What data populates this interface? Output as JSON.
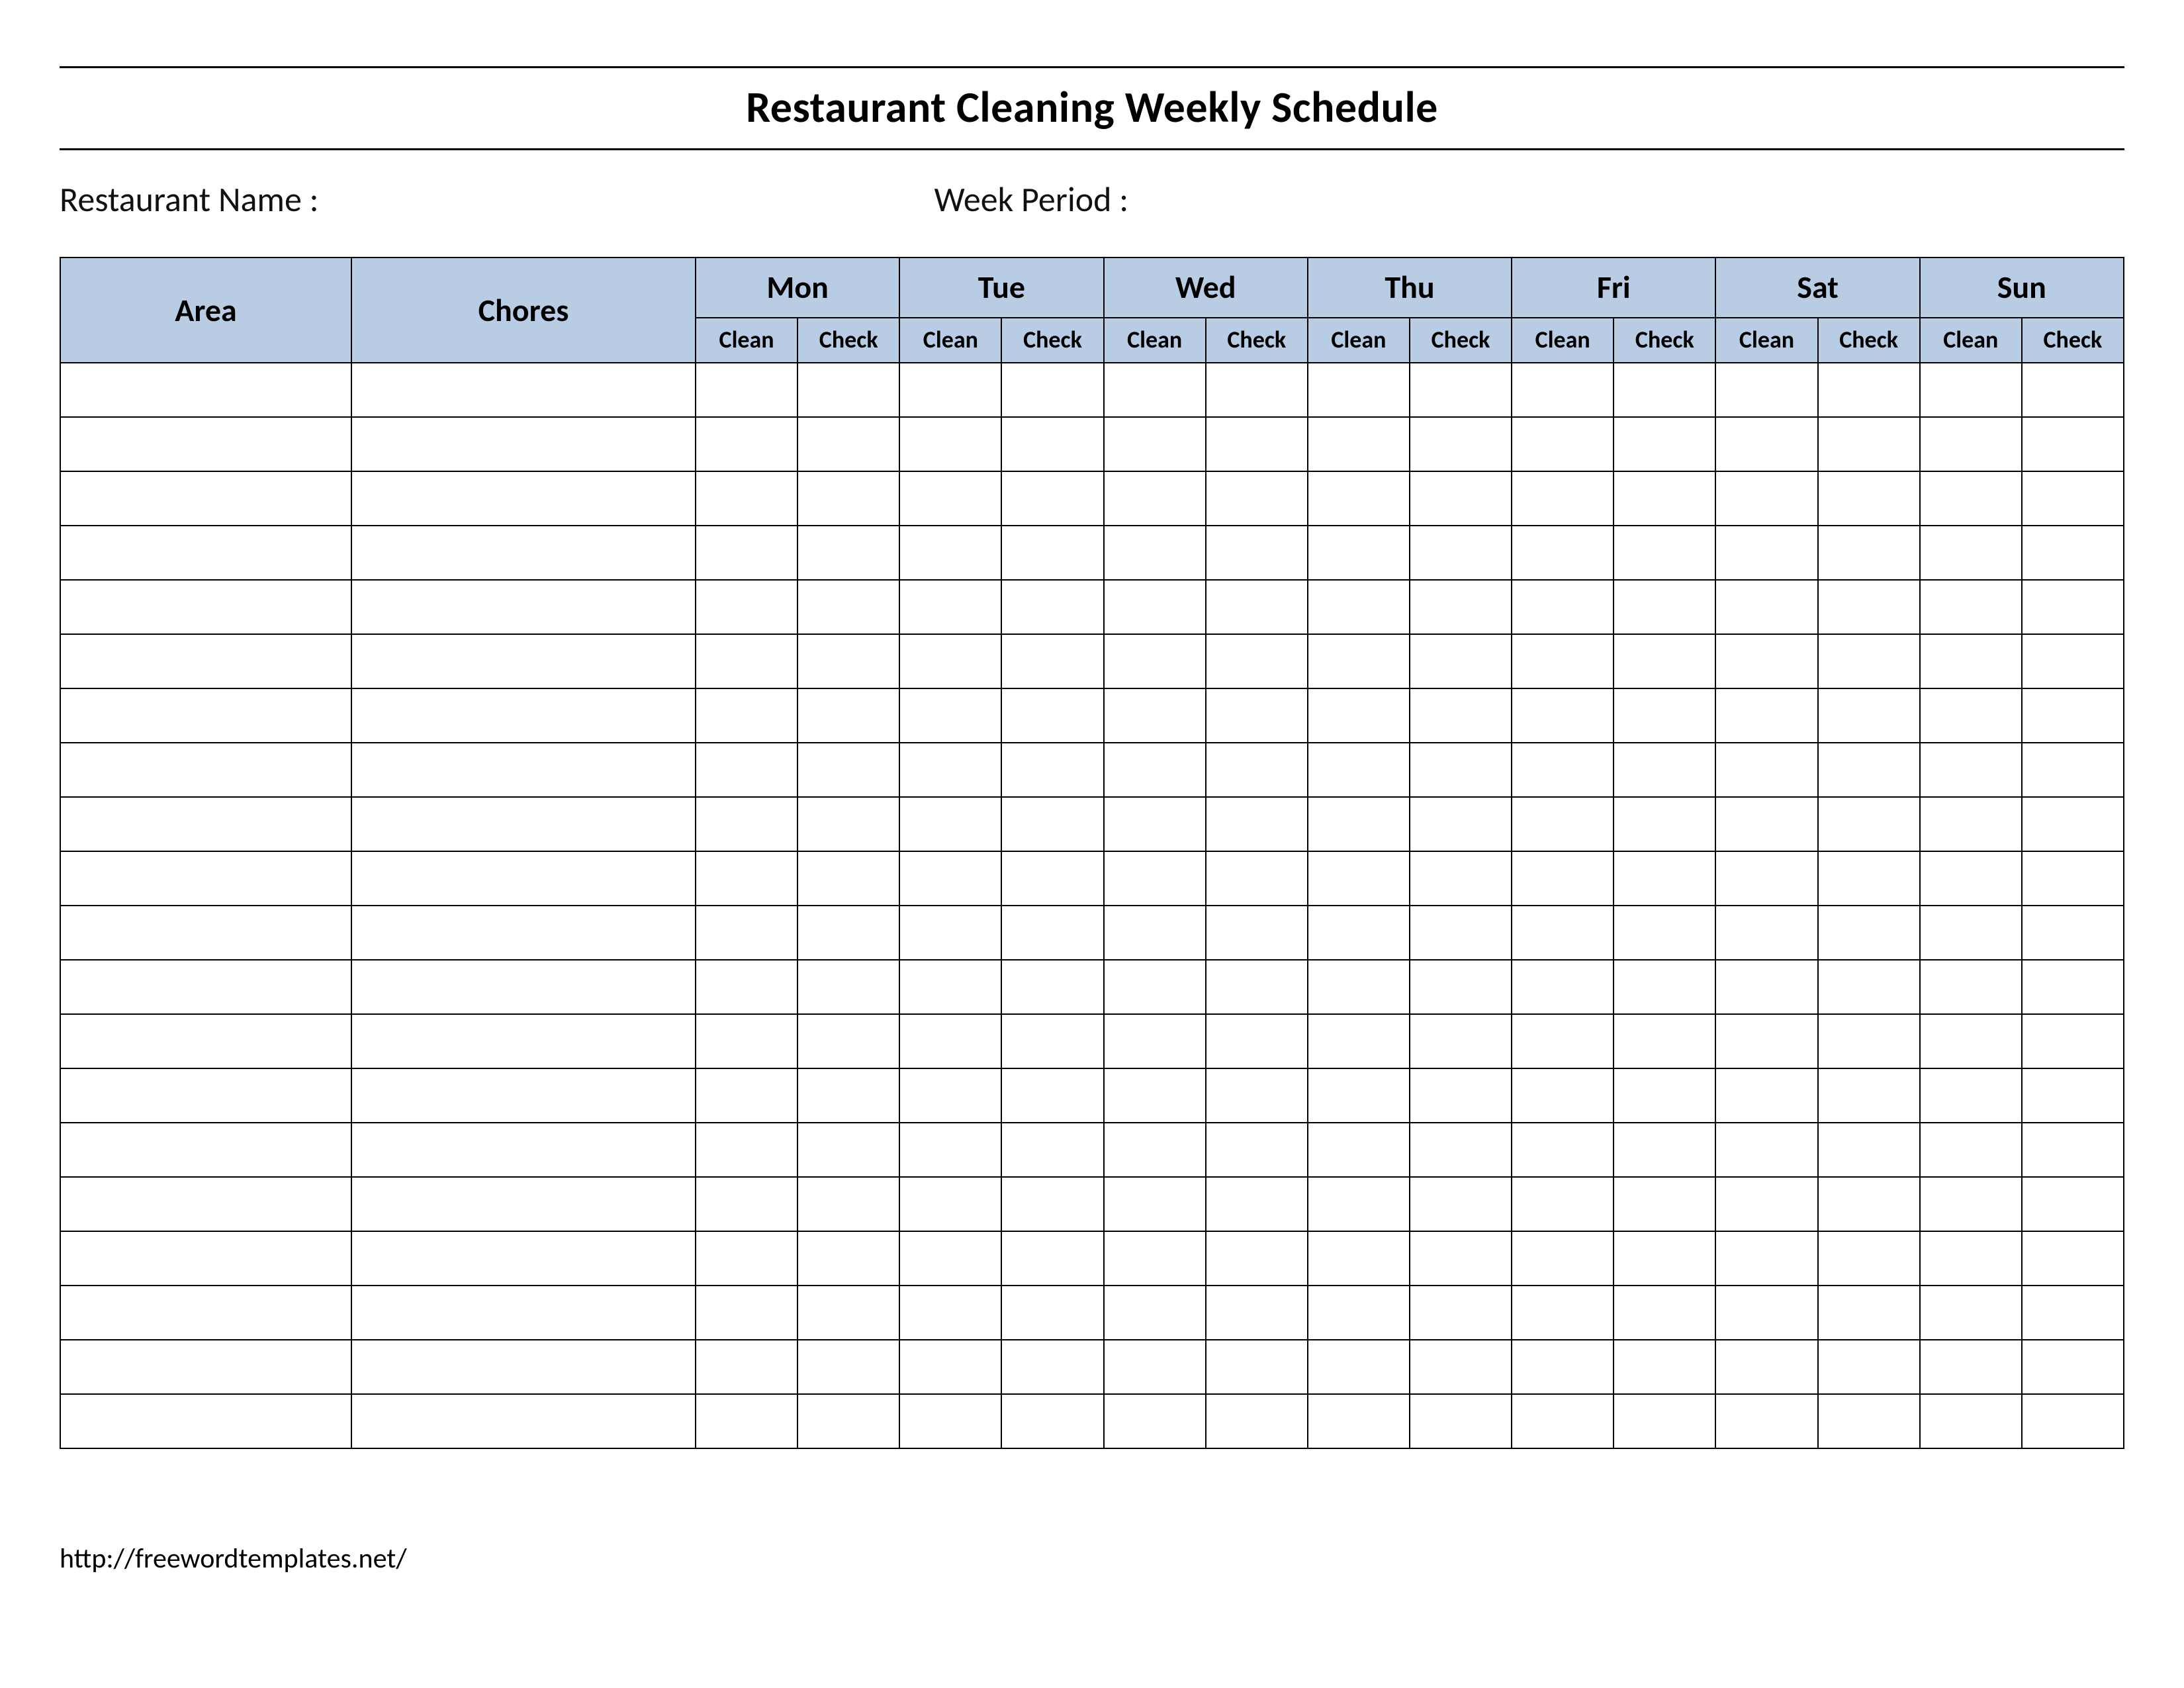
{
  "title": "Restaurant Cleaning Weekly Schedule",
  "meta": {
    "restaurant_name_label": "Restaurant Name   :",
    "week_period_label": "Week  Period :"
  },
  "table": {
    "area_header": "Area",
    "chores_header": "Chores",
    "days": [
      "Mon",
      "Tue",
      "Wed",
      "Thu",
      "Fri",
      "Sat",
      "Sun"
    ],
    "sub_clean": "Clean",
    "sub_check": "Check",
    "row_count": 20
  },
  "footer_url": "http://freewordtemplates.net/"
}
